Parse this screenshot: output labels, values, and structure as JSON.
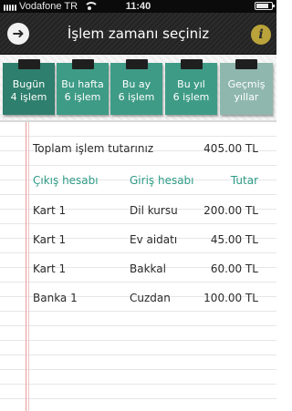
{
  "status_bar": {
    "carrier": "Vodafone TR",
    "time": "11:40"
  },
  "header": {
    "title": "İşlem zamanı seçiniz",
    "back_icon": "back-arrow-icon",
    "info_icon": "info-icon",
    "info_glyph": "i"
  },
  "tabs": [
    {
      "label": "Bugün",
      "sub": "4 işlem",
      "active": true
    },
    {
      "label": "Bu hafta",
      "sub": "6 işlem",
      "active": false
    },
    {
      "label": "Bu ay",
      "sub": "6 işlem",
      "active": false
    },
    {
      "label": "Bu yıl",
      "sub": "6 işlem",
      "active": false
    },
    {
      "label": "Geçmiş",
      "sub": "yıllar",
      "active": false
    }
  ],
  "summary": {
    "label": "Toplam işlem tutarınız",
    "value": "405.00 TL"
  },
  "table": {
    "headers": [
      "Çıkış hesabı",
      "Giriş hesabı",
      "Tutar"
    ],
    "rows": [
      [
        "Kart 1",
        "Dil kursu",
        "200.00 TL"
      ],
      [
        "Kart 1",
        "Ev aidatı",
        "45.00 TL"
      ],
      [
        "Kart 1",
        "Bakkal",
        "60.00 TL"
      ],
      [
        "Banka 1",
        "Cuzdan",
        "100.00 TL"
      ]
    ]
  },
  "colors": {
    "accent": "#2e9b86",
    "tab": "#3e9b86",
    "tab_active": "#2e7f6d",
    "header_bg": "#2a2a2a",
    "margin_line": "#e79a9a"
  }
}
